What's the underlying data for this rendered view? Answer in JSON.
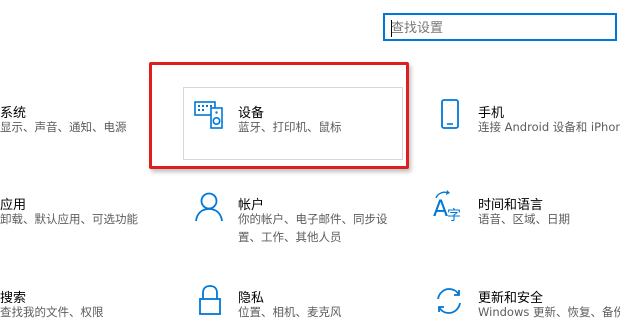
{
  "search": {
    "placeholder": "查找设置"
  },
  "tiles": {
    "system": {
      "title": "系统",
      "desc": [
        "显示、声音、通知、电源"
      ]
    },
    "devices": {
      "title": "设备",
      "desc": [
        "蓝牙、打印机、鼠标"
      ]
    },
    "phone": {
      "title": "手机",
      "desc": [
        "连接 Android 设备和 iPhone"
      ]
    },
    "apps": {
      "title": "应用",
      "desc": [
        "卸载、默认应用、可选功能"
      ]
    },
    "accounts": {
      "title": "帐户",
      "desc": [
        "你的帐户、电子邮件、同步设",
        "置、工作、其他人员"
      ]
    },
    "time": {
      "title": "时间和语言",
      "desc": [
        "语音、区域、日期"
      ]
    },
    "search_tile": {
      "title": "搜索",
      "desc": [
        "查找我的文件、权限"
      ]
    },
    "privacy": {
      "title": "隐私",
      "desc": [
        "位置、相机、麦克风"
      ]
    },
    "update": {
      "title": "更新和安全",
      "desc": [
        "Windows 更新、恢复、备份"
      ]
    }
  },
  "accent_color": "#0078d7",
  "highlight_color": "#dd1f1f"
}
